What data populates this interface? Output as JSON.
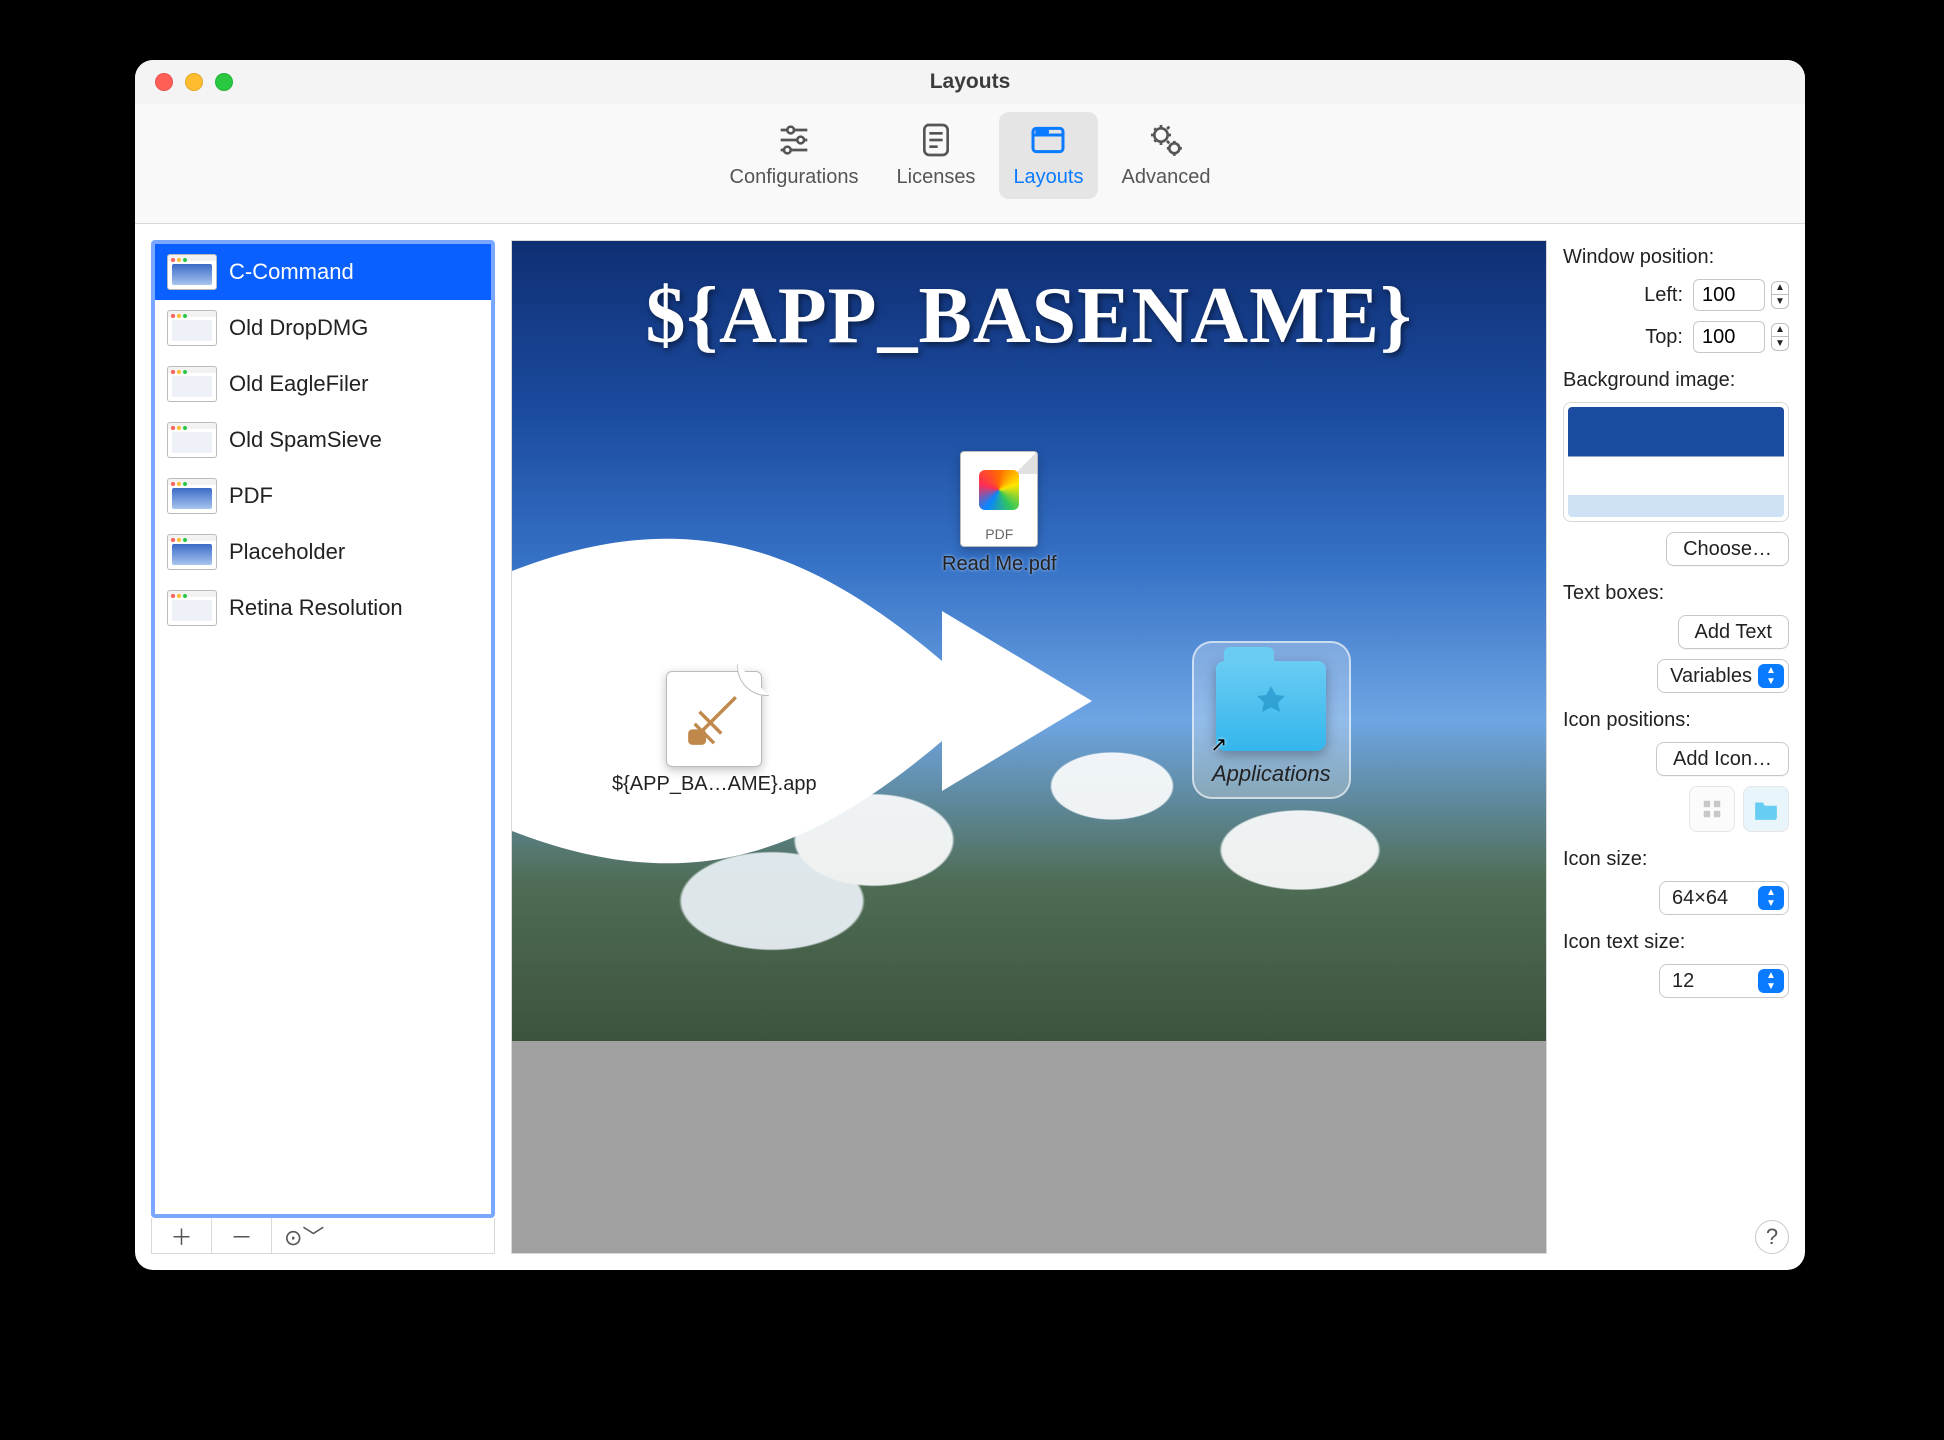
{
  "window": {
    "title": "Layouts"
  },
  "toolbar": {
    "items": [
      {
        "id": "configurations",
        "label": "Configurations"
      },
      {
        "id": "licenses",
        "label": "Licenses"
      },
      {
        "id": "layouts",
        "label": "Layouts",
        "selected": true
      },
      {
        "id": "advanced",
        "label": "Advanced"
      }
    ]
  },
  "sidebar": {
    "items": [
      {
        "label": "C-Command",
        "selected": true,
        "thumb": "sky"
      },
      {
        "label": "Old DropDMG",
        "selected": false,
        "thumb": "light"
      },
      {
        "label": "Old EagleFiler",
        "selected": false,
        "thumb": "light"
      },
      {
        "label": "Old SpamSieve",
        "selected": false,
        "thumb": "light"
      },
      {
        "label": "PDF",
        "selected": false,
        "thumb": "sky"
      },
      {
        "label": "Placeholder",
        "selected": false,
        "thumb": "sky"
      },
      {
        "label": "Retina Resolution",
        "selected": false,
        "thumb": "light"
      }
    ],
    "toolbar": {
      "add_glyph": "＋",
      "remove_glyph": "－",
      "action_glyph": "⊙﹀"
    }
  },
  "canvas": {
    "title": "${APP_BASENAME}",
    "icons": {
      "app_label": "${APP_BA…AME}.app",
      "readme_label": "Read Me.pdf",
      "readme_badge": "PDF",
      "applications_label": "Applications"
    }
  },
  "panel": {
    "window_position_label": "Window position:",
    "left_label": "Left:",
    "left_value": "100",
    "top_label": "Top:",
    "top_value": "100",
    "bg_label": "Background image:",
    "choose_btn": "Choose…",
    "textboxes_label": "Text boxes:",
    "add_text_btn": "Add Text",
    "variables_label": "Variables",
    "iconpos_label": "Icon positions:",
    "add_icon_btn": "Add Icon…",
    "iconsize_label": "Icon size:",
    "iconsize_value": "64×64",
    "icontext_label": "Icon text size:",
    "icontext_value": "12",
    "help_glyph": "?"
  }
}
